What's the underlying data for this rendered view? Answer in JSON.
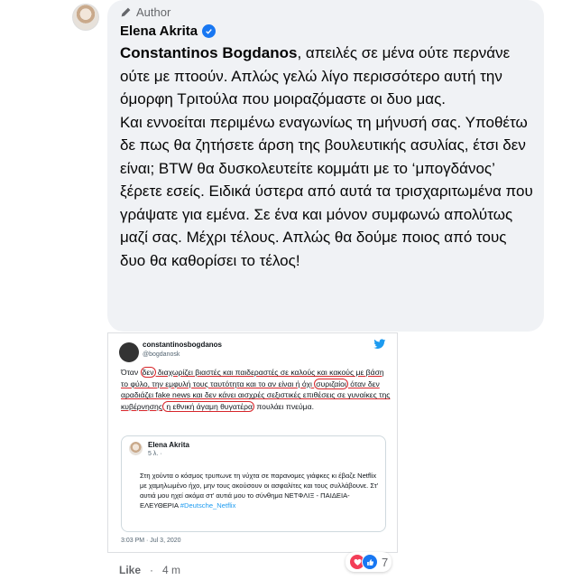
{
  "comment": {
    "badge_label": "Author",
    "author_name": "Elena Akrita",
    "mention": "Constantinos Bogdanos",
    "text_after_mention": ", απειλές σε μένα ούτε περνάνε ούτε με πτοούν. Απλώς γελώ λίγο περισσότερο αυτή την όμορφη Τριτούλα που μοιραζόμαστε οι δυο μας.",
    "paragraph_2": "Και εννοείται περιμένω εναγωνίως τη μήνυσή σας. Υποθέτω δε πως θα ζητήσετε άρση της βουλευτικής ασυλίας, έτσι δεν είναι; BTW θα δυσκολευτείτε κομμάτι με το ‘μπογδάνος’ ξέρετε εσείς. Ειδικά ύστερα από αυτά τα τρισχαριτωμένα που γράψατε για εμένα. Σε ένα και μόνον συμφωνώ απολύτως μαζί σας. Μέχρι τέλους. Απλώς θα δούμε ποιος από τους δυο θα καθορίσει το τέλος!"
  },
  "tweet": {
    "display_name": "constantinosbogdanos",
    "handle": "@bogdanosk",
    "text_parts": [
      "Όταν ",
      "δεν",
      " διαχωρίζει βιαστές και παιδεραστές σε καλούς και κακούς με βάση το φύλο, την εμφυλή τους ταυτότητα και το αν είναι ή όχι ",
      "συριζαίοι",
      " όταν δεν αραδιάζει fake news και δεν κάνει αισχρές σεξιστικές επιθέσεις σε γυναίκες της κυβέρνησης",
      " η εθνική άγαμη θυγατέρα",
      " πουλάει πνεύμα."
    ],
    "quoted": {
      "author": "Elena Akrita",
      "time": "5 λ. ·",
      "text": "Στη χούντα ο κόσμος τρυπωνε τη νύχτα σε παρανομες γιάφκες κι έβαζε Netflix με χαμηλωμένο ήχο, μην τους ακούσουν οι ασφαλίτες και τους συλλάβουνε. Στ' αυτιά μου ηχεί ακόμα στ' αυτιά μου το σύνθημα ΝΕΤΦΛΙΞ - ΠΑΙΔΕΙΑ- ΕΛΕΥΘΕΡΙΑ ",
      "hashtag": "#Deutsche_Netflix"
    },
    "timestamp": "3:03 PM · Jul 3, 2020"
  },
  "footer": {
    "like_label": "Like",
    "separator": "·",
    "time": "4 m"
  },
  "reactions": {
    "count": "7",
    "types": [
      "heart-icon",
      "like-icon"
    ]
  },
  "colors": {
    "bubble_bg": "#f0f2f5",
    "verified_blue": "#1877f2",
    "heart_red": "#f33e58",
    "annotation_red": "#d7262b",
    "twitter_blue": "#1d9bf0"
  }
}
